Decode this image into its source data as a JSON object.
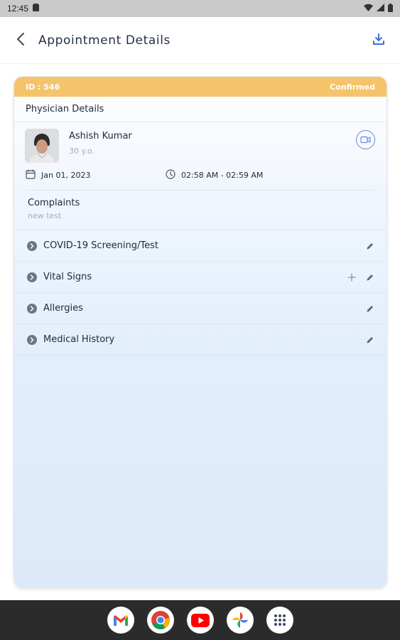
{
  "status_bar": {
    "time": "12:45",
    "icons": [
      "sim-card-icon",
      "wifi-icon",
      "signal-icon",
      "battery-icon"
    ]
  },
  "app_bar": {
    "title": "Appointment Details",
    "icons": [
      "back-arrow-icon",
      "download-icon"
    ]
  },
  "card": {
    "id_label": "ID : 546",
    "status": "Confirmed",
    "section_title": "Physician Details",
    "physician": {
      "name": "Ashish Kumar",
      "age": "30 y.o.",
      "date": "Jan 01, 2023",
      "time": "02:58 AM - 02:59 AM"
    },
    "complaints": {
      "title": "Complaints",
      "text": "new test"
    },
    "sections": [
      {
        "label": "COVID-19 Screening/Test",
        "actions": [
          "edit"
        ]
      },
      {
        "label": "Vital Signs",
        "actions": [
          "add",
          "edit"
        ]
      },
      {
        "label": "Allergies",
        "actions": [
          "edit"
        ]
      },
      {
        "label": "Medical History",
        "actions": [
          "edit"
        ]
      }
    ]
  },
  "colors": {
    "header_accent": "#f5c46a",
    "title_text": "#233047",
    "link_blue": "#3b6fd6",
    "muted_text": "#a5acb8"
  },
  "dock": {
    "apps": [
      "gmail-icon",
      "chrome-icon",
      "youtube-icon",
      "photos-icon",
      "app-drawer-icon"
    ]
  }
}
